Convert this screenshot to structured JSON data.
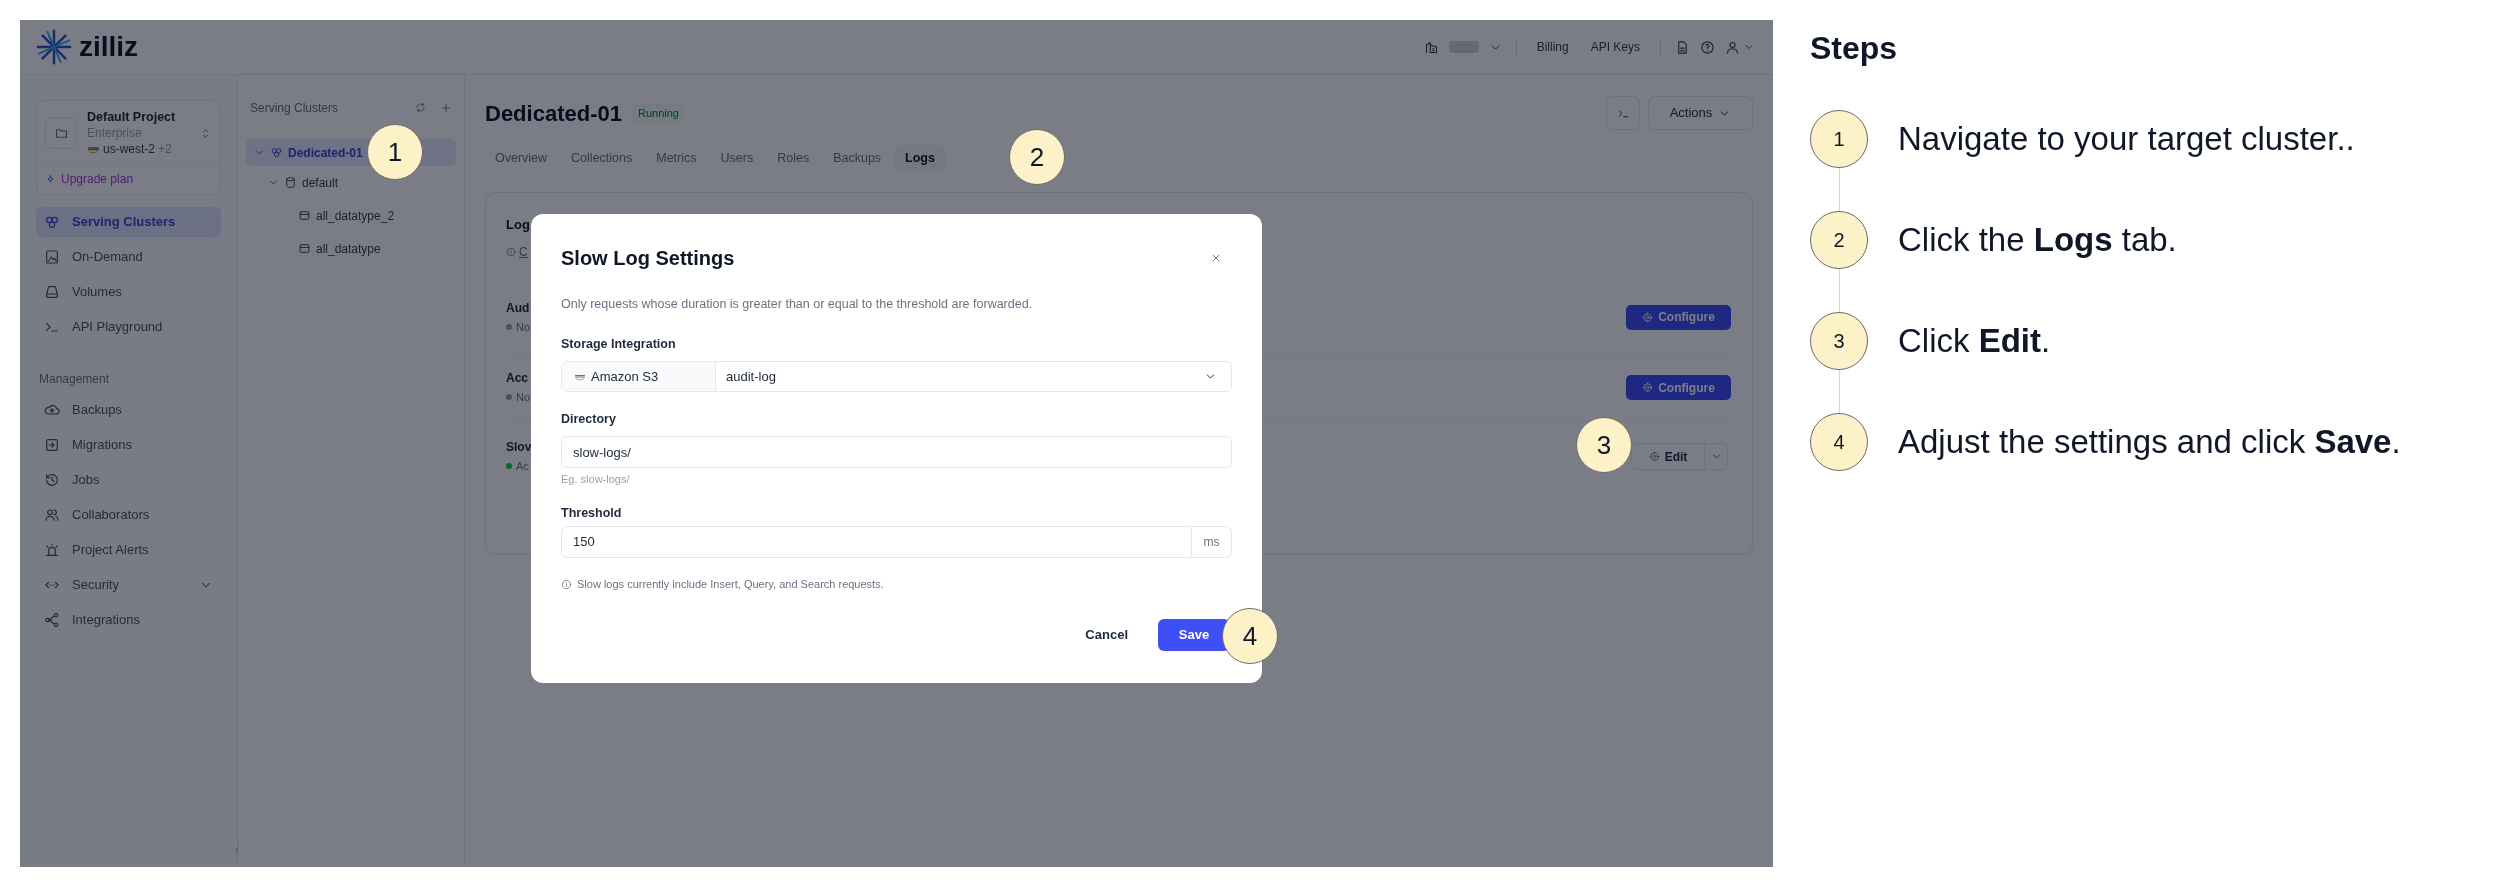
{
  "top_bar": {
    "logo": "zilliz",
    "links": [
      "Billing",
      "API Keys"
    ]
  },
  "sidebar": {
    "project": {
      "name": "Default Project",
      "plan": "Enterprise",
      "region": "us-west-2",
      "region_extra": "+2",
      "upgrade": "Upgrade plan"
    },
    "items": [
      {
        "label": "Serving Clusters",
        "kind": "clusters",
        "selected": true
      },
      {
        "label": "On-Demand",
        "kind": "on-demand",
        "selected": false
      },
      {
        "label": "Volumes",
        "kind": "volumes",
        "selected": false
      },
      {
        "label": "API Playground",
        "kind": "terminal",
        "selected": false
      }
    ],
    "management": {
      "heading": "Management",
      "items": [
        {
          "label": "Backups",
          "kind": "backups",
          "selected": false
        },
        {
          "label": "Migrations",
          "kind": "migrations",
          "selected": false
        },
        {
          "label": "Jobs",
          "kind": "jobs",
          "selected": false
        },
        {
          "label": "Collaborators",
          "kind": "collaborators",
          "selected": false
        },
        {
          "label": "Project Alerts",
          "kind": "alerts",
          "selected": false
        },
        {
          "label": "Security",
          "kind": "security",
          "selected": false,
          "expanded": false
        },
        {
          "label": "Integrations",
          "kind": "integrations",
          "selected": false
        }
      ]
    }
  },
  "clusters_panel": {
    "title": "Serving Clusters",
    "tree": [
      {
        "label": "Dedicated-01",
        "kind": "cluster",
        "selected": true,
        "expanded": true,
        "children": [
          {
            "label": "default",
            "kind": "database",
            "selected": false,
            "expanded": true,
            "children": [
              {
                "label": "all_datatype_2",
                "kind": "collection",
                "selected": false
              },
              {
                "label": "all_datatype",
                "kind": "collection",
                "selected": false
              }
            ]
          }
        ]
      }
    ]
  },
  "main": {
    "title": "Dedicated-01",
    "status": "Running",
    "actions": "Actions",
    "tabs": [
      {
        "label": "Overview",
        "selected": false
      },
      {
        "label": "Collections",
        "selected": false
      },
      {
        "label": "Metrics",
        "selected": false
      },
      {
        "label": "Users",
        "selected": false
      },
      {
        "label": "Roles",
        "selected": false
      },
      {
        "label": "Backups",
        "selected": false
      },
      {
        "label": "Logs",
        "selected": true
      }
    ],
    "logs_card": {
      "title": "Log",
      "subtitle": "C",
      "rows": [
        {
          "name": "Aud",
          "status": "No",
          "color": "#4c5160",
          "kind": "configure",
          "button": "Configure"
        },
        {
          "name": "Acc",
          "status": "No",
          "color": "#4c5160",
          "kind": "configure",
          "button": "Configure"
        },
        {
          "name": "Slov",
          "status": "Ac",
          "color": "#11623a",
          "kind": "edit",
          "button": "Edit"
        }
      ]
    }
  },
  "modal": {
    "title": "Slow Log Settings",
    "description": "Only requests whose duration is greater than or equal to the threshold are forwarded.",
    "fields": [
      {
        "label": "Storage Integration",
        "kind": "select",
        "prefix": "Amazon S3",
        "value": "audit-log"
      },
      {
        "label": "Directory",
        "kind": "text",
        "value": "slow-logs/",
        "hint": "Eg. slow-logs/"
      },
      {
        "label": "Threshold",
        "kind": "number",
        "value": "150",
        "suffix": "ms"
      }
    ],
    "note": "Slow logs currently include Insert, Query, and Search requests.",
    "buttons": [
      {
        "label": "Cancel",
        "kind": "secondary"
      },
      {
        "label": "Save",
        "kind": "primary"
      }
    ]
  },
  "callouts": [
    {
      "label": "1"
    },
    {
      "label": "2"
    },
    {
      "label": "3"
    },
    {
      "label": "4"
    }
  ],
  "steps": {
    "title": "Steps",
    "items": [
      {
        "number": "1",
        "text": "Navigate to your target cluster.."
      },
      {
        "number": "2",
        "text": "Click the **Logs** tab."
      },
      {
        "number": "3",
        "text": "Click **Edit**."
      },
      {
        "number": "4",
        "text": "Adjust the settings and click **Save**."
      }
    ]
  }
}
